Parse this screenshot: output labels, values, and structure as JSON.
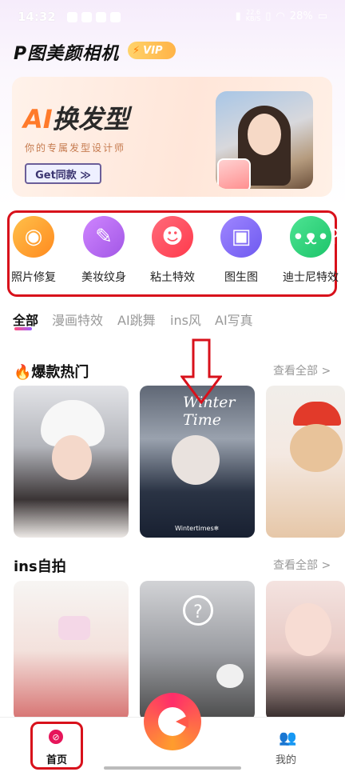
{
  "status_bar": {
    "time": "14:32",
    "speed_value": "22.6",
    "speed_unit": "KB/S",
    "battery": "28%"
  },
  "app": {
    "title": "P图美颜相机",
    "vip_label": "VIP"
  },
  "banner": {
    "title_ai": "AI",
    "title_rest": "换发型",
    "subtitle": "你的专属发型设计师",
    "button_label": "Get同款 ≫"
  },
  "features": [
    {
      "label": "照片修复",
      "icon": "photo-restore-icon",
      "color": "#ffa23a"
    },
    {
      "label": "美妆纹身",
      "icon": "makeup-brush-icon",
      "color": "#b86bf2"
    },
    {
      "label": "粘土特效",
      "icon": "smiley-icon",
      "color": "#ff4d5f"
    },
    {
      "label": "图生图",
      "icon": "image-icon",
      "color": "#8b6cf6"
    },
    {
      "label": "迪士尼特效",
      "icon": "bear-icon",
      "color": "#2ed47a"
    }
  ],
  "tabs": [
    {
      "label": "全部",
      "active": true
    },
    {
      "label": "漫画特效",
      "active": false
    },
    {
      "label": "AI跳舞",
      "active": false
    },
    {
      "label": "ins风",
      "active": false
    },
    {
      "label": "AI写真",
      "active": false
    }
  ],
  "section_hot": {
    "icon": "🔥",
    "title": "爆款热门",
    "more": "查看全部 >"
  },
  "section_ins": {
    "title": "ins自拍",
    "more": "查看全部 >"
  },
  "hot_cards": [
    {
      "overlay": "",
      "colors": [
        "#d7d9de",
        "#8d8f96",
        "#2f2b2c"
      ]
    },
    {
      "overlay": "Winter Time",
      "caption": "Wintertimes❄",
      "colors": [
        "#4e5765",
        "#8a93a2",
        "#1f2735"
      ]
    },
    {
      "overlay": "",
      "colors": [
        "#f3f0ec",
        "#e44a2a",
        "#c9a27a"
      ]
    }
  ],
  "ins_cards": [
    {
      "colors": [
        "#f4f2f0",
        "#f0c9c2",
        "#d86a6a"
      ]
    },
    {
      "colors": [
        "#c9cbcf",
        "#8d8f93",
        "#3a3a3a"
      ]
    },
    {
      "colors": [
        "#f5e6e4",
        "#d9b7b2",
        "#2b2424"
      ]
    }
  ],
  "bottom_nav": {
    "home_label": "首页",
    "me_label": "我的"
  }
}
